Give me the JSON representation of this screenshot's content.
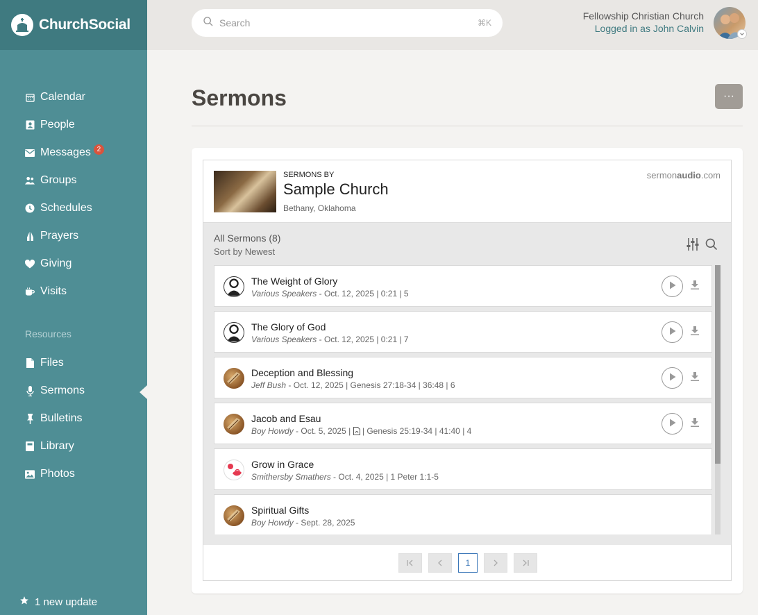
{
  "brand": {
    "name": "ChurchSocial"
  },
  "nav": [
    {
      "label": "Calendar",
      "icon": "calendar-icon"
    },
    {
      "label": "People",
      "icon": "contact-card-icon"
    },
    {
      "label": "Messages",
      "icon": "envelope-icon",
      "badge": "2"
    },
    {
      "label": "Groups",
      "icon": "users-icon"
    },
    {
      "label": "Schedules",
      "icon": "clock-icon"
    },
    {
      "label": "Prayers",
      "icon": "praying-hands-icon"
    },
    {
      "label": "Giving",
      "icon": "heart-icon"
    },
    {
      "label": "Visits",
      "icon": "coffee-icon"
    }
  ],
  "resources_heading": "Resources",
  "resources": [
    {
      "label": "Files",
      "icon": "file-icon"
    },
    {
      "label": "Sermons",
      "icon": "microphone-icon",
      "active": true
    },
    {
      "label": "Bulletins",
      "icon": "thumbtack-icon"
    },
    {
      "label": "Library",
      "icon": "book-icon"
    },
    {
      "label": "Photos",
      "icon": "image-icon"
    }
  ],
  "update": {
    "label": "1 new update"
  },
  "header": {
    "search_placeholder": "Search",
    "search_shortcut": "⌘K",
    "church_name": "Fellowship Christian Church",
    "logged_in": "Logged in as John Calvin"
  },
  "page": {
    "title": "Sermons",
    "more_label": "···"
  },
  "widget": {
    "sermons_by": "SERMONS BY",
    "church_title": "Sample Church",
    "church_location": "Bethany, Oklahoma",
    "logo_prefix": "sermon",
    "logo_bold": "audio",
    "logo_suffix": ".com",
    "all_sermons": "All Sermons",
    "count": "(8)",
    "sort": "Sort by Newest"
  },
  "sermons": [
    {
      "title": "The Weight of Glory",
      "speaker": "Various Speakers",
      "meta": " - Oct. 12, 2025 | 0:21 | 5",
      "thumb": "person",
      "audio": true
    },
    {
      "title": "The Glory of God",
      "speaker": "Various Speakers",
      "meta": " - Oct. 12, 2025 | 0:21 | 7",
      "thumb": "person",
      "audio": true
    },
    {
      "title": "Deception and Blessing",
      "speaker": "Jeff Bush",
      "meta": " - Oct. 12, 2025 | Genesis 27:18-34 | 36:48 | 6",
      "thumb": "bible",
      "audio": true
    },
    {
      "title": "Jacob and Esau",
      "speaker": "Boy Howdy",
      "meta": " - Oct. 5, 2025 | ",
      "meta2": " | Genesis 25:19-34 | 41:40 | 4",
      "pdf": true,
      "thumb": "bible",
      "audio": true
    },
    {
      "title": "Grow in Grace",
      "speaker": "Smithersby Smathers",
      "meta": " - Oct. 4, 2025 | 1 Peter 1:1-5",
      "thumb": "grace",
      "audio": false
    },
    {
      "title": "Spiritual Gifts",
      "speaker": "Boy Howdy",
      "meta": " - Sept. 28, 2025",
      "thumb": "bible",
      "audio": false
    }
  ],
  "pager": {
    "current": "1"
  }
}
